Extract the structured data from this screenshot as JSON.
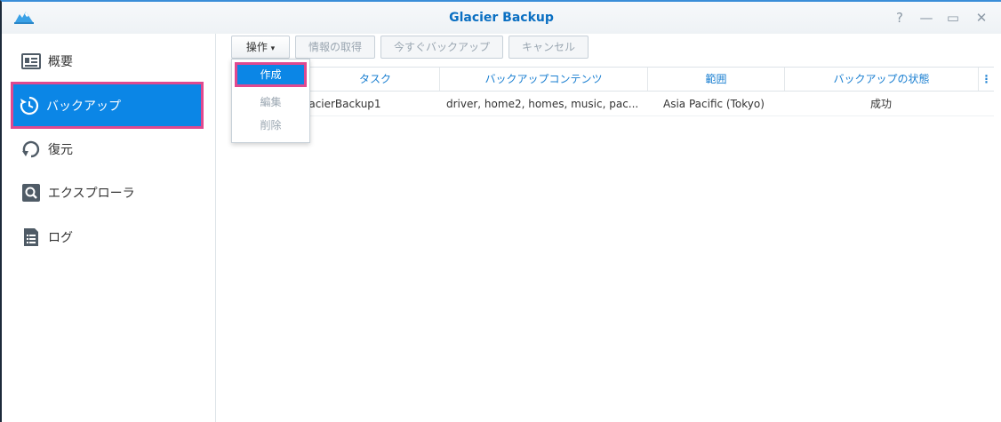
{
  "window": {
    "title": "Glacier Backup"
  },
  "sidebar": {
    "items": [
      {
        "label": "概要",
        "icon": "overview-icon"
      },
      {
        "label": "バックアップ",
        "icon": "backup-icon"
      },
      {
        "label": "復元",
        "icon": "restore-icon"
      },
      {
        "label": "エクスプローラ",
        "icon": "explorer-icon"
      },
      {
        "label": "ログ",
        "icon": "log-icon"
      }
    ]
  },
  "toolbar": {
    "action_label": "操作",
    "info_label": "情報の取得",
    "backup_now_label": "今すぐバックアップ",
    "cancel_label": "キャンセル"
  },
  "menu": {
    "create_label": "作成",
    "edit_label": "編集",
    "delete_label": "削除"
  },
  "table": {
    "columns": [
      "タスク",
      "バックアップコンテンツ",
      "範囲",
      "バックアップの状態"
    ],
    "rows": [
      [
        "lacierBackup1",
        "driver, home2, homes, music, pac...",
        "Asia Pacific (Tokyo)",
        "成功"
      ]
    ]
  },
  "colors": {
    "accent": "#0b86e6",
    "highlight": "#e0498f",
    "title": "#0a6fc2"
  }
}
